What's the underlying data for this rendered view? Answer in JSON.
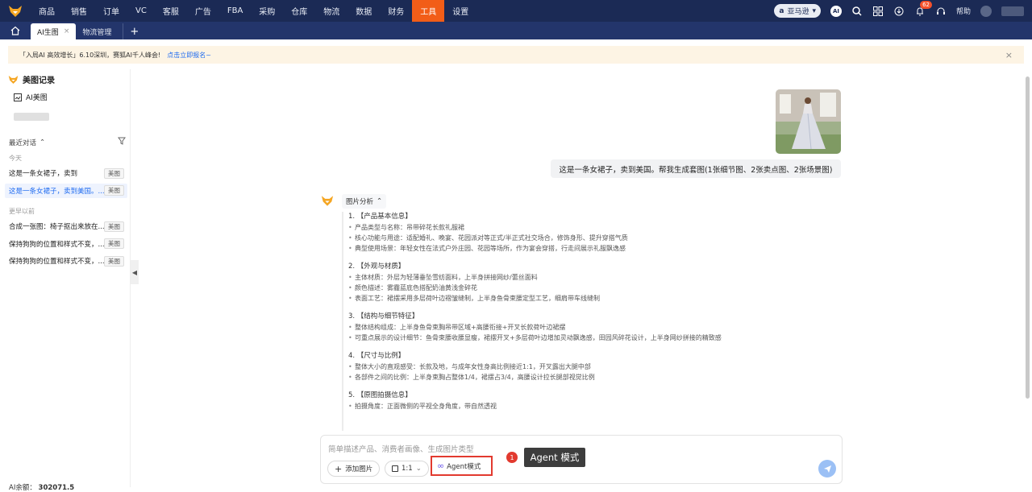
{
  "nav": {
    "items": [
      "商品",
      "销售",
      "订单",
      "VC",
      "客服",
      "广告",
      "FBA",
      "采购",
      "仓库",
      "物流",
      "数据",
      "财务",
      "工具",
      "设置"
    ],
    "active_index": 12,
    "store": "亚马逊",
    "ai": "AI",
    "notif_count": "62",
    "help": "帮助"
  },
  "tabs": {
    "items": [
      {
        "label": "AI生图",
        "active": true
      },
      {
        "label": "物流管理",
        "active": false
      }
    ],
    "close_glyph": "×",
    "add_glyph": "+"
  },
  "notice": {
    "text": "「入局AI 高效增长」6.10深圳，赛狐AI千人峰会!",
    "link": "点击立即报名~",
    "close": "×"
  },
  "sidebar": {
    "title": "美图记录",
    "ai_item": "AI美图",
    "recent_label": "最近对话",
    "recent_chevron": "^",
    "group_today": "今天",
    "group_earlier": "更早以前",
    "today": [
      {
        "text": "这是一条女裙子，卖到",
        "tag": "美图",
        "selected": false
      },
      {
        "text": "这是一条女裙子，卖到美国。...",
        "tag": "美图",
        "selected": true
      }
    ],
    "earlier": [
      {
        "text": "合成一张图：椅子抠出来放在...",
        "tag": "美图"
      },
      {
        "text": "保持狗狗的位置和样式不变，...",
        "tag": "美图"
      },
      {
        "text": "保持狗狗的位置和样式不变，...",
        "tag": "美图"
      }
    ],
    "bottom_label": "AI余额：",
    "bottom_value": "302071.5",
    "collapse_glyph": "◀"
  },
  "chat": {
    "user_message": "这是一条女裙子，卖到美国。帮我生成套图(1张细节图、2张卖点图、2张场景图)",
    "analysis_title": "图片分析",
    "sections": [
      {
        "heading": "1. 【产品基本信息】",
        "bullets": [
          "产品类型与名称：吊带碎花长款礼服裙",
          "核心功能与用途：适配婚礼、晚宴、花园派对等正式/半正式社交场合，修饰身形、提升穿搭气质",
          "典型使用场景：年轻女性在法式户外庄园、花园等场所，作为宴会穿搭，行走间展示礼服飘逸感"
        ]
      },
      {
        "heading": "2. 【外观与材质】",
        "bullets": [
          "主体材质：外层为轻薄垂坠雪纺面料，上半身拼接网纱/蕾丝面料",
          "颜色描述：雾霾蓝底色搭配奶油黄浅金碎花",
          "表面工艺：裙摆采用多层荷叶边褶皱缝制，上半身鱼骨束腰定型工艺，细肩带车线缝制"
        ]
      },
      {
        "heading": "3. 【结构与细节特征】",
        "bullets": [
          "整体结构组成：上半身鱼骨束胸吊带区域+高腰衔接+开叉长款荷叶边裙摆",
          "可重点展示的设计细节：鱼骨束腰收腰显瘦，裙摆开叉+多层荷叶边增加灵动飘逸感，田园风碎花设计，上半身网纱拼接的精致感"
        ]
      },
      {
        "heading": "4. 【尺寸与比例】",
        "bullets": [
          "整体大小的直观感受：长款及地，与成年女性身高比例接近1:1，开叉露出大腿中部",
          "各部件之间的比例：上半身束胸占整体1/4，裙摆占3/4，高腰设计拉长腿部视觉比例"
        ]
      },
      {
        "heading": "5. 【原图拍摄信息】",
        "bullets": [
          "拍摄角度：正面微侧的平视全身角度，带自然透视"
        ]
      }
    ]
  },
  "input": {
    "placeholder": "简单描述产品、消费者画像、生成图片类型",
    "add_image": "添加图片",
    "ratio": "1:1",
    "agent": "Agent模式"
  },
  "annotation": {
    "number": "1",
    "tooltip": "Agent 模式"
  },
  "colors": {
    "nav_bg": "#1b2a55",
    "accent": "#f25d18",
    "link": "#1f6bf0",
    "highlight_box": "#e23a2f"
  }
}
